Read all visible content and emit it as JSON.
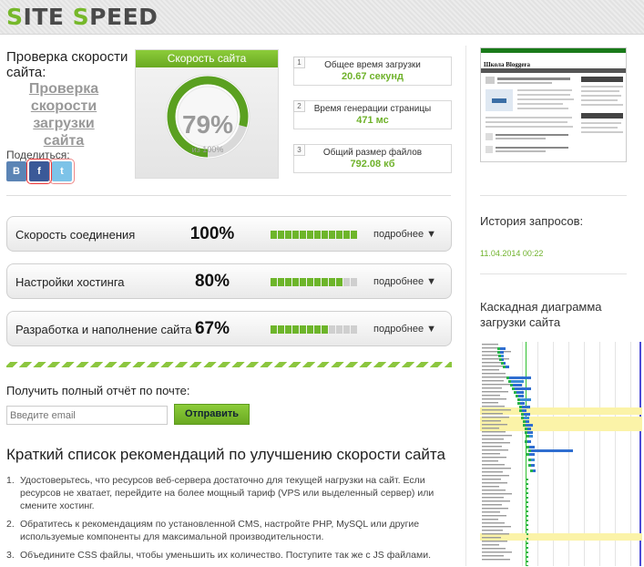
{
  "header": {
    "logo_s1": "S",
    "logo_mid": "ITE ",
    "logo_s2": "S",
    "logo_end": "PEED"
  },
  "left": {
    "title": "Проверка скорости сайта:",
    "link": "Проверка скорости загрузки сайта",
    "share_label": "Поделиться:"
  },
  "share": {
    "vk": "B",
    "fb": "f",
    "tw": "t"
  },
  "gauge": {
    "title": "Скорость сайта",
    "value_label": "79%",
    "value": 79,
    "of_label": "из 100%"
  },
  "stats": [
    {
      "num": "1",
      "label": "Общее время загрузки",
      "value": "20.67 секунд"
    },
    {
      "num": "2",
      "label": "Время генерации страницы",
      "value": "471 мс"
    },
    {
      "num": "3",
      "label": "Общий размер файлов",
      "value": "792.08 кб"
    }
  ],
  "metrics": [
    {
      "name": "Скорость соединения",
      "pct": "100%",
      "fill": 1.0,
      "more": "подробнее"
    },
    {
      "name": "Настройки хостинга",
      "pct": "80%",
      "fill": 0.8,
      "more": "подробнее"
    },
    {
      "name": "Разработка и наполнение сайта",
      "pct": "67%",
      "fill": 0.67,
      "more": "подробнее"
    }
  ],
  "email": {
    "label": "Получить полный отчёт по почте:",
    "placeholder": "Введите email",
    "button": "Отправить"
  },
  "recommendations": {
    "title": "Краткий список рекомендаций по улучшению скорости сайта",
    "items": [
      {
        "num": "1.",
        "text": "Удостоверьтесь, что ресурсов веб-сервера достаточно для текущей нагрузки на сайт. Если ресурсов не хватает, перейдите на более мощный тариф (VPS или выделенный сервер) или смените хостинг."
      },
      {
        "num": "2.",
        "text": "Обратитесь к рекомендациям по установленной CMS, настройте PHP, MySQL или другие используемые компоненты для максимальной производительности."
      },
      {
        "num": "3.",
        "text": "Объедините CSS файлы, чтобы уменьшить их количество. Поступите так же с JS файлами."
      }
    ]
  },
  "thumbnail": {
    "site_title": "Школа Bloggera"
  },
  "history": {
    "title": "История запросов:",
    "date": "11.04.2014 00:22"
  },
  "waterfall": {
    "title": "Каскадная диаграмма загрузки сайта"
  },
  "colors": {
    "accent": "#6fb22b",
    "bar_off": "#cfcfcf"
  }
}
